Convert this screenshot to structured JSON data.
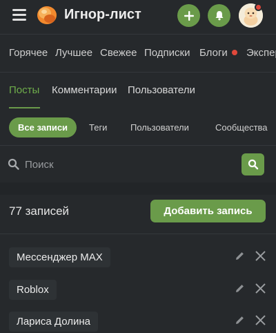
{
  "header": {
    "title": "Игнор-лист",
    "icons": [
      "menu-icon",
      "logo",
      "plus-icon",
      "bell-icon",
      "avatar"
    ],
    "accent": "#6a9b4a",
    "notification_dot": "#e0483b"
  },
  "categories": [
    "Горячее",
    "Лучшее",
    "Свежее",
    "Подписки",
    "Блоги",
    "Экспер"
  ],
  "tabs": [
    {
      "label": "Посты",
      "active": true
    },
    {
      "label": "Комментарии",
      "active": false
    },
    {
      "label": "Пользователи",
      "active": false
    }
  ],
  "filters": [
    {
      "label": "Все записи",
      "active": true
    },
    {
      "label": "Теги",
      "active": false
    },
    {
      "label": "Пользователи",
      "active": false
    },
    {
      "label": "Сообщества",
      "active": false
    }
  ],
  "search": {
    "placeholder": "Поиск",
    "value": ""
  },
  "summary": {
    "count_label": "77 записей",
    "add_button": "Добавить запись"
  },
  "items": [
    {
      "label": "Мессенджер MAX"
    },
    {
      "label": "Roblox"
    },
    {
      "label": "Лариса Долина"
    }
  ]
}
